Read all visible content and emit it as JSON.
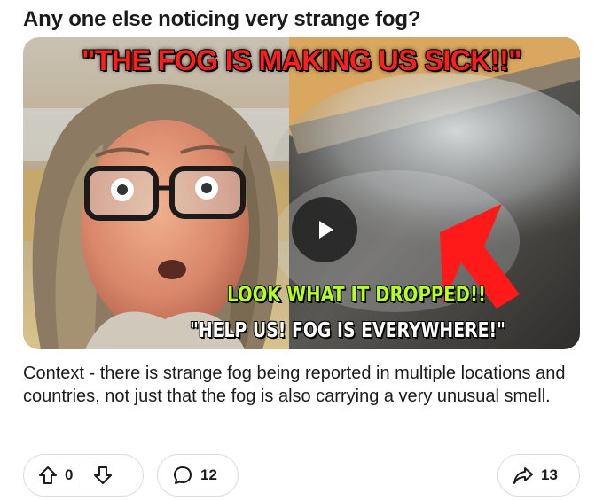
{
  "post": {
    "title": "Any one else noticing very strange fog?",
    "body": "Context - there is strange fog being reported in multiple locations and countries, not just that the fog is also carrying a very unusual smell."
  },
  "thumbnail": {
    "caption_top": "\"THE FOG IS MAKING US SICK!!\"",
    "caption_line1": "LOOK WHAT IT DROPPED!!",
    "caption_line2": "\"HELP US! FOG IS EVERYWHERE!\"",
    "caption_top_color": "#ff1e1e",
    "caption_line1_color": "#b6ff1e",
    "arrow_color": "#ff1a1a"
  },
  "actions": {
    "upvote_count": "0",
    "comment_count": "12",
    "share_count": "13"
  },
  "icons": [
    "arrow-up-icon",
    "arrow-down-icon",
    "comment-bubble-icon",
    "share-arrow-icon",
    "play-icon"
  ]
}
